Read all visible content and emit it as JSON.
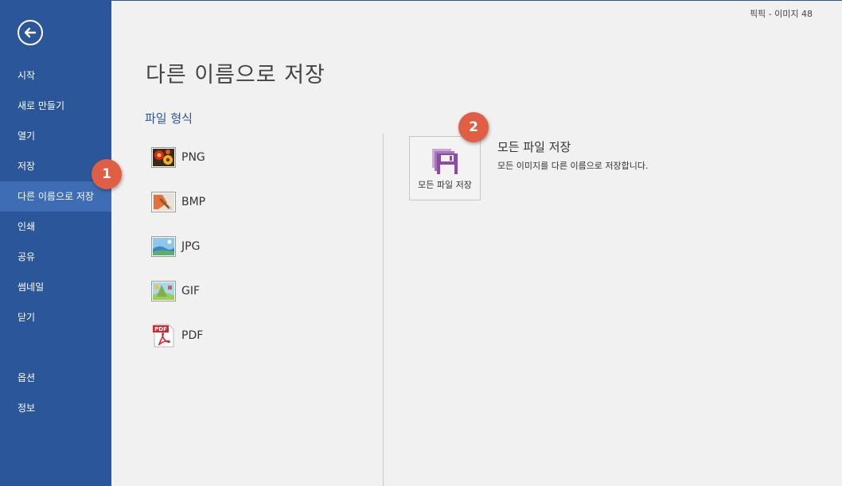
{
  "window": {
    "title": "픽픽 - 이미지 48"
  },
  "sidebar": {
    "items": [
      {
        "label": "시작"
      },
      {
        "label": "새로 만들기"
      },
      {
        "label": "열기"
      },
      {
        "label": "저장"
      },
      {
        "label": "다른 이름으로 저장",
        "active": true
      },
      {
        "label": "인쇄"
      },
      {
        "label": "공유"
      },
      {
        "label": "썸네일"
      },
      {
        "label": "닫기"
      },
      {
        "label": "옵션"
      },
      {
        "label": "정보"
      }
    ]
  },
  "main": {
    "title": "다른 이름으로 저장",
    "section_title": "파일 형식",
    "formats": [
      {
        "label": "PNG",
        "icon": "png-image-icon"
      },
      {
        "label": "BMP",
        "icon": "bmp-paint-icon"
      },
      {
        "label": "JPG",
        "icon": "jpg-landscape-icon"
      },
      {
        "label": "GIF",
        "icon": "gif-image-icon"
      },
      {
        "label": "PDF",
        "icon": "pdf-acrobat-icon"
      }
    ],
    "save_all": {
      "tile_label": "모든 파일 저장",
      "title": "모든 파일 저장",
      "description": "모든 이미지를 다른 이름으로 저장합니다."
    }
  },
  "markers": {
    "step1": "1",
    "step2": "2"
  },
  "colors": {
    "sidebar": "#2b579a",
    "active": "#3e6db5",
    "accent": "#2b579a",
    "marker": "#e05e43",
    "save_icon": "#8e4aa6"
  }
}
